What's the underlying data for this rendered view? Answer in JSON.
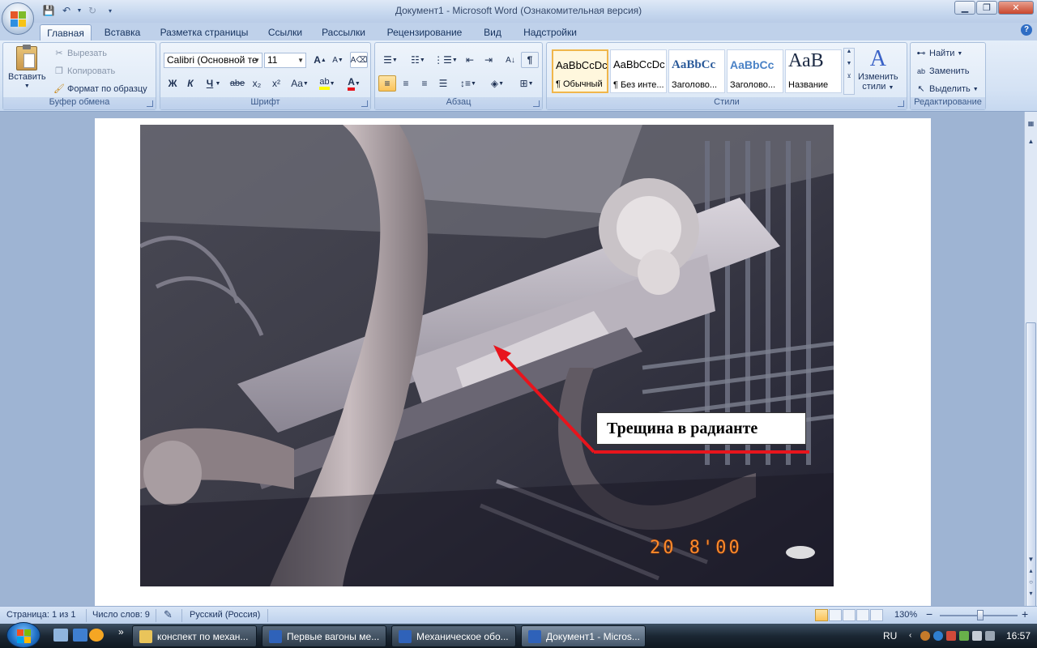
{
  "window": {
    "title": "Документ1 - Microsoft Word (Ознакомительная версия)"
  },
  "tabs": [
    "Главная",
    "Вставка",
    "Разметка страницы",
    "Ссылки",
    "Рассылки",
    "Рецензирование",
    "Вид",
    "Надстройки"
  ],
  "clipboard": {
    "paste": "Вставить",
    "cut": "Вырезать",
    "copy": "Копировать",
    "format_painter": "Формат по образцу",
    "label": "Буфер обмена"
  },
  "font": {
    "name": "Calibri (Основной те",
    "size": "11",
    "label": "Шрифт",
    "bold": "Ж",
    "italic": "К",
    "underline": "Ч",
    "strike": "abe",
    "subscript": "x₂",
    "superscript": "x²",
    "change_case": "Aa",
    "grow": "A",
    "shrink": "A",
    "font_color": "A"
  },
  "paragraph": {
    "label": "Абзац",
    "pilcrow": "¶"
  },
  "styles": {
    "label": "Стили",
    "items": [
      {
        "sample": "AaBbCcDc",
        "name": "¶ Обычный"
      },
      {
        "sample": "AaBbCcDc",
        "name": "¶ Без инте..."
      },
      {
        "sample": "AaBbCc",
        "name": "Заголово..."
      },
      {
        "sample": "AaBbCc",
        "name": "Заголово..."
      },
      {
        "sample": "АаВ",
        "name": "Название"
      }
    ],
    "change_styles_line1": "Изменить",
    "change_styles_line2": "стили"
  },
  "editing": {
    "find": "Найти",
    "replace": "Заменить",
    "select": "Выделить",
    "label": "Редактирование"
  },
  "document": {
    "callout_text": "Трещина в радианте",
    "date_stamp": "20  8'00"
  },
  "status": {
    "page": "Страница: 1 из 1",
    "words": "Число слов: 9",
    "language": "Русский (Россия)",
    "zoom": "130%",
    "zoom_minus": "−",
    "zoom_plus": "+"
  },
  "taskbar": {
    "tasks": [
      "конспект по механ...",
      "Первые вагоны ме...",
      "Механическое обо...",
      "Документ1 - Micros..."
    ],
    "lang": "RU",
    "time": "16:57",
    "more": "»"
  },
  "colors": {
    "callout_arrow": "#e8141c",
    "date_stamp": "#ff8a2a",
    "ribbon_bg": "#d4e2f4"
  }
}
